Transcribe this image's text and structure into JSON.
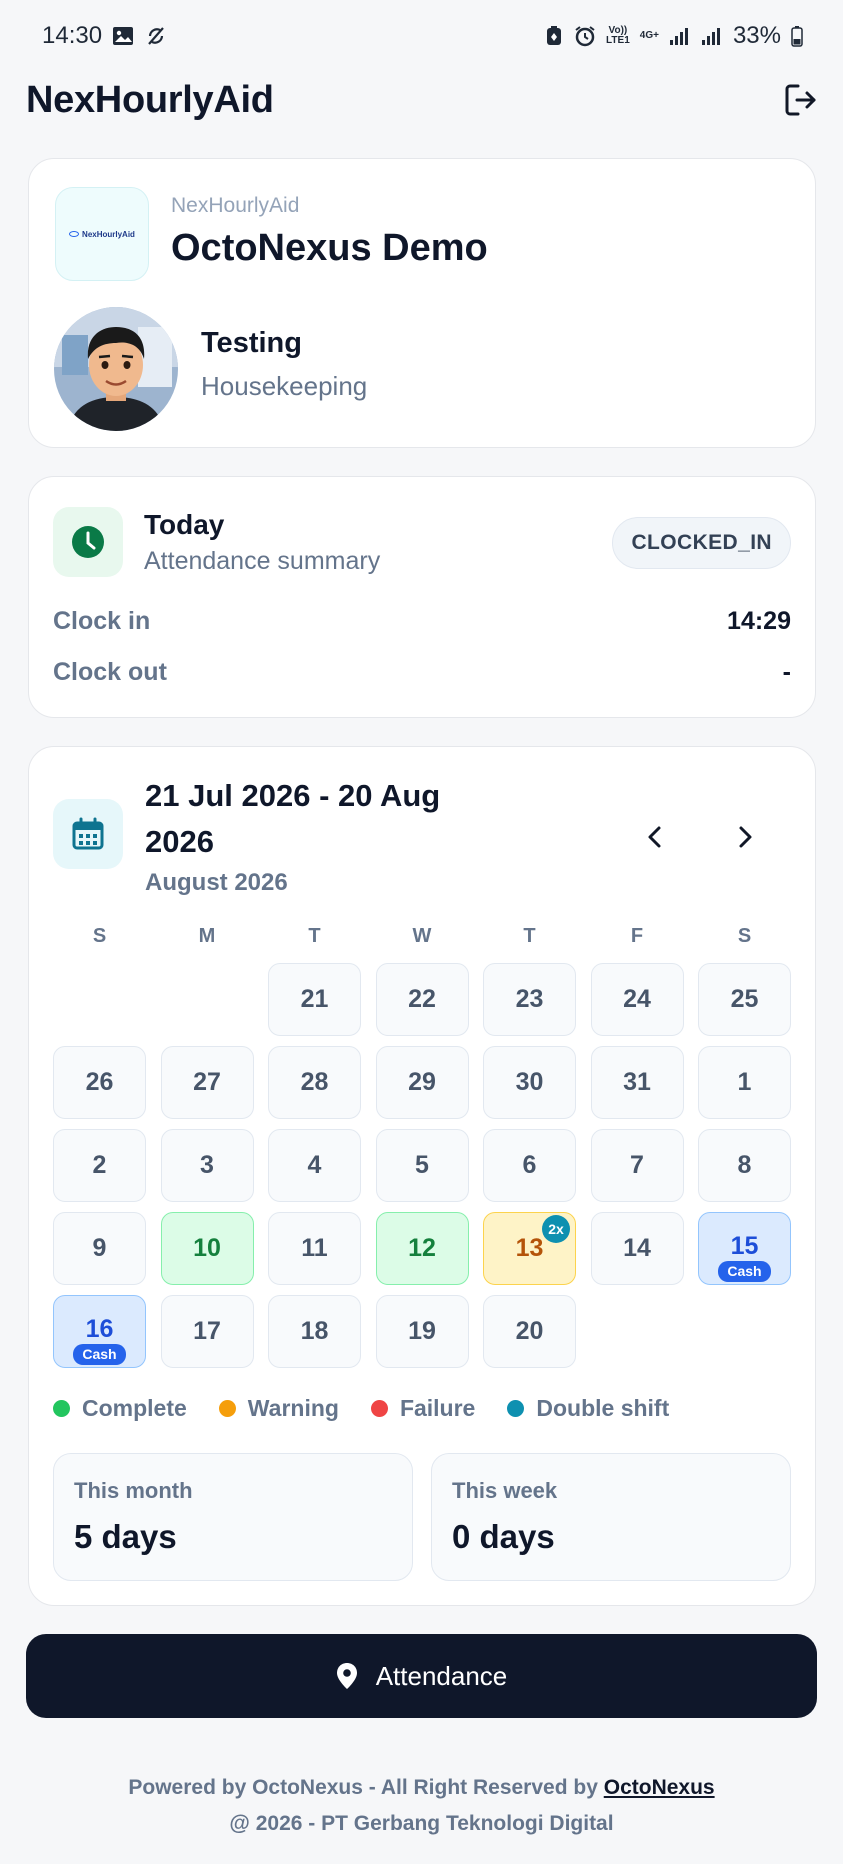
{
  "status_bar": {
    "time": "14:30",
    "network_top": "Vo))",
    "network_bottom": "LTE1",
    "gen": "4G+",
    "battery": "33%"
  },
  "header": {
    "title": "NexHourlyAid"
  },
  "company": {
    "logo_text": "NexHourlyAid",
    "app_name": "NexHourlyAid",
    "name": "OctoNexus Demo"
  },
  "user": {
    "name": "Testing",
    "department": "Housekeeping"
  },
  "today": {
    "title": "Today",
    "subtitle": "Attendance summary",
    "status": "CLOCKED_IN",
    "clock_in_label": "Clock in",
    "clock_in_value": "14:29",
    "clock_out_label": "Clock out",
    "clock_out_value": "-"
  },
  "calendar": {
    "range": "21 Jul 2026 - 20 Aug 2026",
    "month": "August 2026",
    "weekdays": [
      "S",
      "M",
      "T",
      "W",
      "T",
      "F",
      "S"
    ],
    "cash_label": "Cash",
    "double_label": "2x",
    "days": [
      {
        "d": ""
      },
      {
        "d": ""
      },
      {
        "d": "21"
      },
      {
        "d": "22"
      },
      {
        "d": "23"
      },
      {
        "d": "24"
      },
      {
        "d": "25"
      },
      {
        "d": "26"
      },
      {
        "d": "27"
      },
      {
        "d": "28"
      },
      {
        "d": "29"
      },
      {
        "d": "30"
      },
      {
        "d": "31"
      },
      {
        "d": "1"
      },
      {
        "d": "2"
      },
      {
        "d": "3"
      },
      {
        "d": "4"
      },
      {
        "d": "5"
      },
      {
        "d": "6"
      },
      {
        "d": "7"
      },
      {
        "d": "8"
      },
      {
        "d": "9"
      },
      {
        "d": "10",
        "status": "complete"
      },
      {
        "d": "11"
      },
      {
        "d": "12",
        "status": "complete"
      },
      {
        "d": "13",
        "status": "warning",
        "double": true
      },
      {
        "d": "14"
      },
      {
        "d": "15",
        "status": "cash",
        "cash": true
      },
      {
        "d": "16",
        "status": "cash",
        "cash": true
      },
      {
        "d": "17"
      },
      {
        "d": "18"
      },
      {
        "d": "19"
      },
      {
        "d": "20"
      }
    ],
    "legend": [
      {
        "label": "Complete",
        "color": "#22c55e"
      },
      {
        "label": "Warning",
        "color": "#f59e0b"
      },
      {
        "label": "Failure",
        "color": "#ef4444"
      },
      {
        "label": "Double shift",
        "color": "#0e90b0"
      }
    ],
    "stats": {
      "month_label": "This month",
      "month_value": "5 days",
      "week_label": "This week",
      "week_value": "0 days"
    }
  },
  "attendance_button": {
    "label": "Attendance"
  },
  "footer": {
    "line1_prefix": "Powered by OctoNexus - All Right Reserved by",
    "link": "OctoNexus",
    "line2": "@ 2026 - PT Gerbang Teknologi Digital"
  }
}
